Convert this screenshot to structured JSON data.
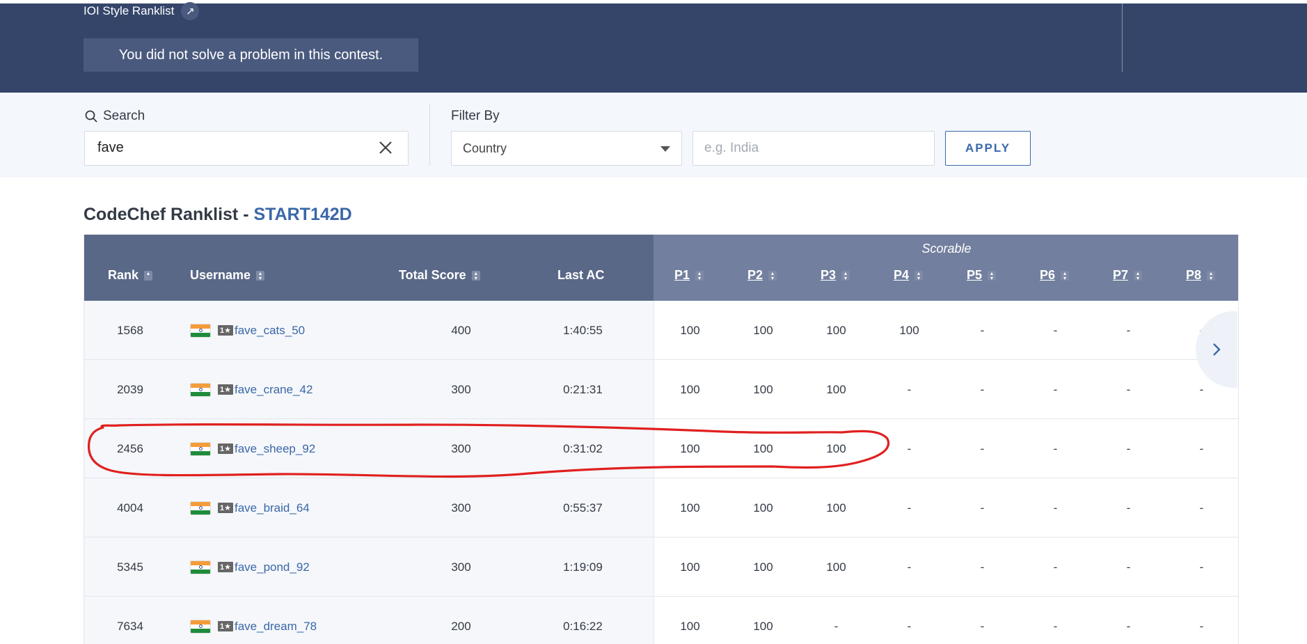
{
  "banner": {
    "ioi_link_label": "IOI Style Ranklist",
    "notice": "You did not solve a problem in this contest."
  },
  "filters": {
    "search_label": "Search",
    "search_value": "fave",
    "filter_by_label": "Filter By",
    "filter_select_value": "Country",
    "country_placeholder": "e.g. India",
    "apply_label": "APPLY"
  },
  "ranklist": {
    "title_prefix": "CodeChef Ranklist - ",
    "contest_code": "START142D",
    "scorable_label": "Scorable",
    "columns": {
      "rank": "Rank",
      "username": "Username",
      "total_score": "Total Score",
      "last_ac": "Last AC",
      "problems": [
        "P1",
        "P2",
        "P3",
        "P4",
        "P5",
        "P6",
        "P7",
        "P8"
      ]
    },
    "rows": [
      {
        "rank": "1568",
        "stars": "1★",
        "username": "fave_cats_50",
        "total": "400",
        "last_ac": "1:40:55",
        "scores": [
          "100",
          "100",
          "100",
          "100",
          "-",
          "-",
          "-",
          "-"
        ]
      },
      {
        "rank": "2039",
        "stars": "1★",
        "username": "fave_crane_42",
        "total": "300",
        "last_ac": "0:21:31",
        "scores": [
          "100",
          "100",
          "100",
          "-",
          "-",
          "-",
          "-",
          "-"
        ]
      },
      {
        "rank": "2456",
        "stars": "1★",
        "username": "fave_sheep_92",
        "total": "300",
        "last_ac": "0:31:02",
        "scores": [
          "100",
          "100",
          "100",
          "-",
          "-",
          "-",
          "-",
          "-"
        ]
      },
      {
        "rank": "4004",
        "stars": "1★",
        "username": "fave_braid_64",
        "total": "300",
        "last_ac": "0:55:37",
        "scores": [
          "100",
          "100",
          "100",
          "-",
          "-",
          "-",
          "-",
          "-"
        ]
      },
      {
        "rank": "5345",
        "stars": "1★",
        "username": "fave_pond_92",
        "total": "300",
        "last_ac": "1:19:09",
        "scores": [
          "100",
          "100",
          "100",
          "-",
          "-",
          "-",
          "-",
          "-"
        ]
      },
      {
        "rank": "7634",
        "stars": "1★",
        "username": "fave_dream_78",
        "total": "200",
        "last_ac": "0:16:22",
        "scores": [
          "100",
          "100",
          "-",
          "-",
          "-",
          "-",
          "-",
          "-"
        ]
      }
    ]
  },
  "colors": {
    "banner_bg": "#35456a",
    "accent": "#3a67a8",
    "highlight_ink": "#e0201f"
  }
}
